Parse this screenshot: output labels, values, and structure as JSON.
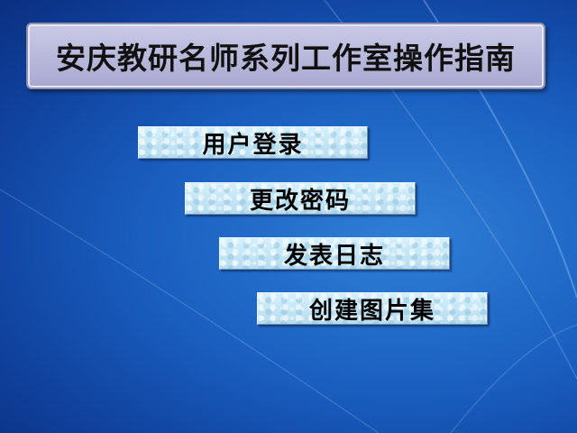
{
  "title": "安庆教研名师系列工作室操作指南",
  "menu": {
    "items": [
      {
        "label": "用户登录"
      },
      {
        "label": "更改密码"
      },
      {
        "label": "发表日志"
      },
      {
        "label": "创建图片集"
      }
    ]
  },
  "colors": {
    "background": "#1a5fc0",
    "title_bar": "#b9b9dc",
    "button": "#bfe3f2",
    "text": "#000000"
  }
}
